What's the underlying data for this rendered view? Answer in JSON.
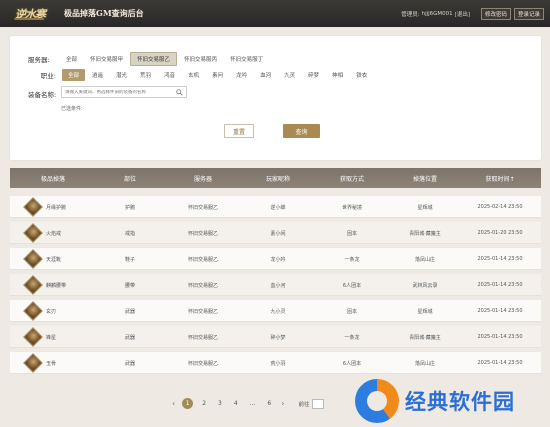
{
  "header": {
    "title": "极品掉落GM查询后台",
    "admin_label": "管理员:",
    "admin_name": "hjjj6GM001",
    "logout": "[退出]",
    "btn1": "修改密码",
    "btn2": "登录记录"
  },
  "filters": {
    "server_label": "服务器:",
    "servers": [
      "全部",
      "怀旧交易服甲",
      "怀旧交易服乙",
      "怀旧交易服丙",
      "怀旧交易服丁"
    ],
    "class_label": "职业:",
    "classes": [
      "全部",
      "逍遥",
      "潜光",
      "荒羽",
      "鸿音",
      "玄机",
      "素问",
      "龙吟",
      "血河",
      "九灵",
      "碎梦",
      "神相",
      "铁衣"
    ],
    "equip_label": "装备名称:",
    "search_placeholder": "请输入关键词、例选择怀旧的装备的名称",
    "selected_condition": "已选条件:",
    "reset": "重置",
    "query": "查询"
  },
  "table": {
    "columns": [
      "极品掉落",
      "部位",
      "服务器",
      "玩家昵称",
      "获取方式",
      "掉落位置",
      "获取时间↑"
    ],
    "rows": [
      {
        "name": "月缘护腕",
        "part": "护腕",
        "server": "怀旧交易服乙",
        "player": "逆小蝉",
        "method": "世界秘境",
        "location": "星辉城",
        "time": "2025-02-14 23:50"
      },
      {
        "name": "火焰戒",
        "part": "戒指",
        "server": "怀旧交易服乙",
        "player": "素小闲",
        "method": "固本",
        "location": "青阳城·藏魔主",
        "time": "2025-01-20 23:50"
      },
      {
        "name": "天涯靴",
        "part": "鞋子",
        "server": "怀旧交易服乙",
        "player": "龙小吟",
        "method": "一条龙",
        "location": "落凤山庄",
        "time": "2025-01-14 23:50"
      },
      {
        "name": "麒麟腰带",
        "part": "腰带",
        "server": "怀旧交易服乙",
        "player": "血小河",
        "method": "6人团本",
        "location": "武林风云录",
        "time": "2025-01-14 23:50"
      },
      {
        "name": "玄刃",
        "part": "武器",
        "server": "怀旧交易服乙",
        "player": "九小灵",
        "method": "固本",
        "location": "星辉城",
        "time": "2025-01-14 23:50"
      },
      {
        "name": "锋星",
        "part": "武器",
        "server": "怀旧交易服乙",
        "player": "碎小梦",
        "method": "一条龙",
        "location": "青阳城·藏魔主",
        "time": "2025-01-14 23:50"
      },
      {
        "name": "玉骨",
        "part": "武器",
        "server": "怀旧交易服乙",
        "player": "荒小羽",
        "method": "6人团本",
        "location": "落凤山庄",
        "time": "2025-01-14 23:50"
      }
    ]
  },
  "pagination": {
    "pages": [
      "1",
      "2",
      "3",
      "4",
      "...",
      "6"
    ],
    "current": "1",
    "prev": "‹",
    "next": "›",
    "goto": "前往"
  },
  "watermark": {
    "text": "经典软件园"
  },
  "colors": {
    "accent": "#b29c6d",
    "header_bg": "#2f2d2a",
    "table_head": "#857b70",
    "watermark_blue": "#2b6fd6",
    "watermark_orange": "#f08a1a"
  }
}
